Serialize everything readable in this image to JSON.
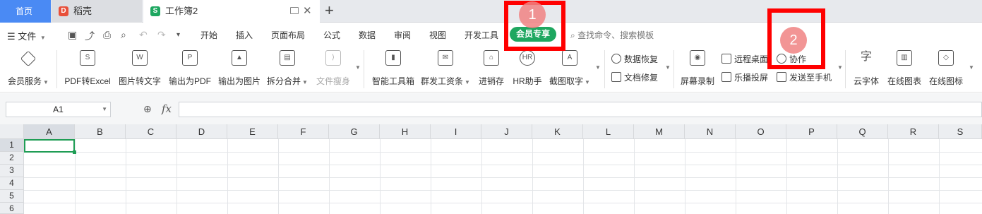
{
  "tabs": {
    "home": "首页",
    "daoke": "稻壳",
    "workbook": "工作簿2",
    "add": "+"
  },
  "menu": {
    "file": "文件",
    "items": [
      "开始",
      "插入",
      "页面布局",
      "公式",
      "数据",
      "审阅",
      "视图",
      "开发工具"
    ],
    "vip": "会员专享",
    "search_placeholder": "查找命令、搜索模板"
  },
  "ribbon": {
    "large": [
      {
        "label": "会员服务",
        "icon": "diamond-icon"
      },
      {
        "label": "PDF转Excel",
        "icon": "pdf-to-excel-icon"
      },
      {
        "label": "图片转文字",
        "icon": "image-to-text-icon"
      },
      {
        "label": "输出为PDF",
        "icon": "export-pdf-icon"
      },
      {
        "label": "输出为图片",
        "icon": "export-image-icon"
      },
      {
        "label": "拆分合并",
        "icon": "split-merge-icon"
      },
      {
        "label": "文件瘦身",
        "icon": "file-slim-icon"
      },
      {
        "label": "智能工具箱",
        "icon": "smart-toolbox-icon"
      },
      {
        "label": "群发工资条",
        "icon": "payroll-icon"
      },
      {
        "label": "进销存",
        "icon": "inventory-icon"
      },
      {
        "label": "HR助手",
        "icon": "hr-assistant-icon"
      },
      {
        "label": "截图取字",
        "icon": "screenshot-ocr-icon"
      },
      {
        "label": "屏幕录制",
        "icon": "screen-record-icon"
      },
      {
        "label": "云字体",
        "icon": "cloud-font-icon"
      },
      {
        "label": "在线图表",
        "icon": "online-chart-icon"
      },
      {
        "label": "在线图标",
        "icon": "online-icon-icon"
      }
    ],
    "small": {
      "data_recovery": "数据恢复",
      "doc_repair": "文档修复",
      "remote_desktop": "远程桌面",
      "collaborate": "协作",
      "broadcast": "乐播投屏",
      "send_phone": "发送至手机"
    }
  },
  "formula_bar": {
    "cell_ref": "A1",
    "fx": "fx",
    "formula": ""
  },
  "grid": {
    "columns": [
      "A",
      "B",
      "C",
      "D",
      "E",
      "F",
      "G",
      "H",
      "I",
      "J",
      "K",
      "L",
      "M",
      "N",
      "O",
      "P",
      "Q",
      "R",
      "S"
    ],
    "rows": [
      "1",
      "2",
      "3",
      "4",
      "5",
      "6"
    ]
  },
  "annotations": {
    "marker1": "1",
    "marker2": "2"
  },
  "colors": {
    "home_tab": "#4a8af4",
    "vip_green": "#1ea760",
    "active_cell": "#1f9d55",
    "annotation_red": "#ff0000"
  }
}
